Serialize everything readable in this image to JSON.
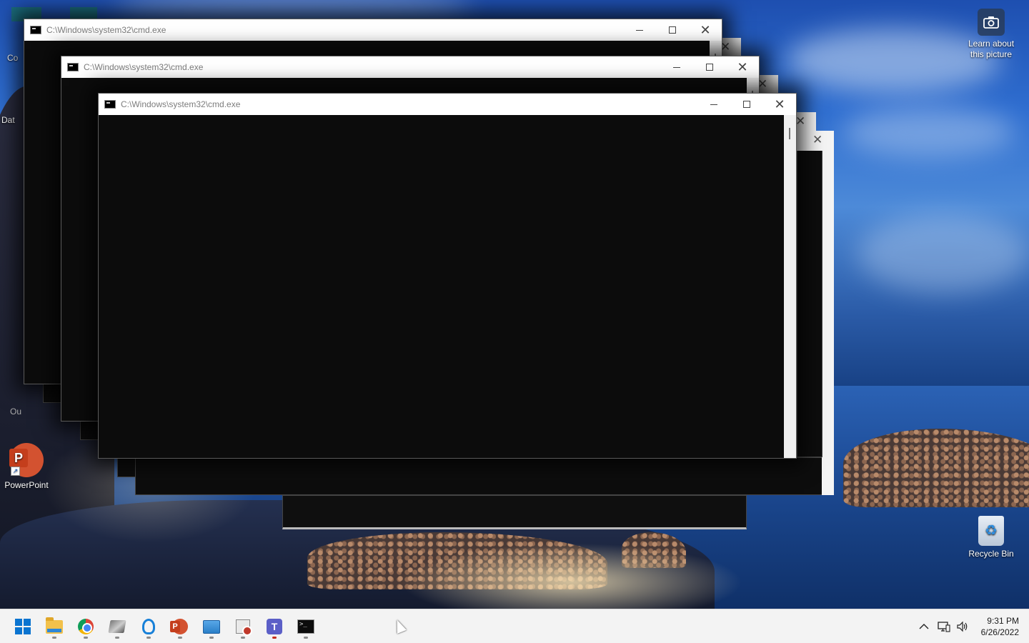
{
  "desktop": {
    "learn_icon": {
      "label_line1": "Learn about",
      "label_line2": "this picture",
      "icon": "camera-icon"
    },
    "powerpoint_icon": {
      "label": "PowerPoint",
      "letter": "P"
    },
    "recycle_bin_icon": {
      "label": "Recycle Bin"
    },
    "partial_labels": {
      "left1": "Co",
      "left2": "Dat",
      "left3": "Ou"
    }
  },
  "windows": [
    {
      "title": "C:\\Windows\\system32\\cmd.exe"
    },
    {
      "title": "C:\\Windows\\system32\\cmd.exe"
    },
    {
      "title": "C:\\Windows\\system32\\cmd.exe"
    }
  ],
  "window_controls": {
    "minimize": "─",
    "maximize": "☐",
    "close": "✕"
  },
  "taskbar": {
    "apps": [
      {
        "name": "start-button",
        "icon": "windows-start-icon",
        "running": false
      },
      {
        "name": "file-explorer",
        "icon": "folder-icon",
        "running": true
      },
      {
        "name": "chrome",
        "icon": "chrome-icon",
        "running": true
      },
      {
        "name": "tool-app",
        "icon": "tool-icon",
        "running": true
      },
      {
        "name": "tips-app",
        "icon": "lightbulb-icon",
        "running": true
      },
      {
        "name": "powerpoint",
        "icon": "powerpoint-icon",
        "running": true
      },
      {
        "name": "remote-desktop",
        "icon": "remote-desktop-icon",
        "running": true
      },
      {
        "name": "image-app",
        "icon": "image-icon",
        "running": true
      },
      {
        "name": "teams",
        "icon": "teams-icon",
        "running": true,
        "attention": true
      },
      {
        "name": "command-prompt",
        "icon": "cmd-icon",
        "running": true
      }
    ],
    "tray": {
      "chevron": "^",
      "network_icon": "network-icon",
      "volume_icon": "speaker-icon"
    },
    "clock": {
      "time": "9:31 PM",
      "date": "6/26/2022"
    }
  }
}
